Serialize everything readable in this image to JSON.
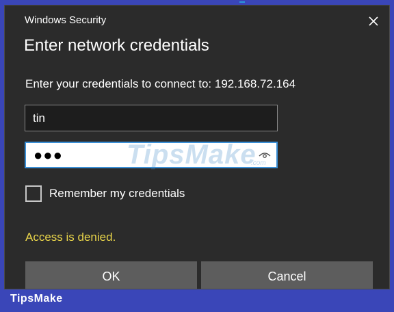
{
  "window": {
    "title": "Windows Security",
    "close_icon": "close-icon"
  },
  "dialog": {
    "heading": "Enter network credentials",
    "prompt": "Enter your credentials to connect to: 192.168.72.164",
    "username_value": "tin",
    "password_masked": "●●●",
    "reveal_icon": "eye-icon",
    "remember_label": "Remember my credentials",
    "remember_checked": false,
    "error_message": "Access is denied.",
    "ok_label": "OK",
    "cancel_label": "Cancel"
  },
  "watermark": {
    "text": "TipsMake",
    "suffix": ".com"
  },
  "footer": {
    "brand": "TipsMake"
  },
  "colors": {
    "background": "#3a46b8",
    "dialog": "#2b2b2b",
    "error": "#e8d44a",
    "focus_border": "#3a8fd6",
    "button": "#5d5d5d"
  }
}
